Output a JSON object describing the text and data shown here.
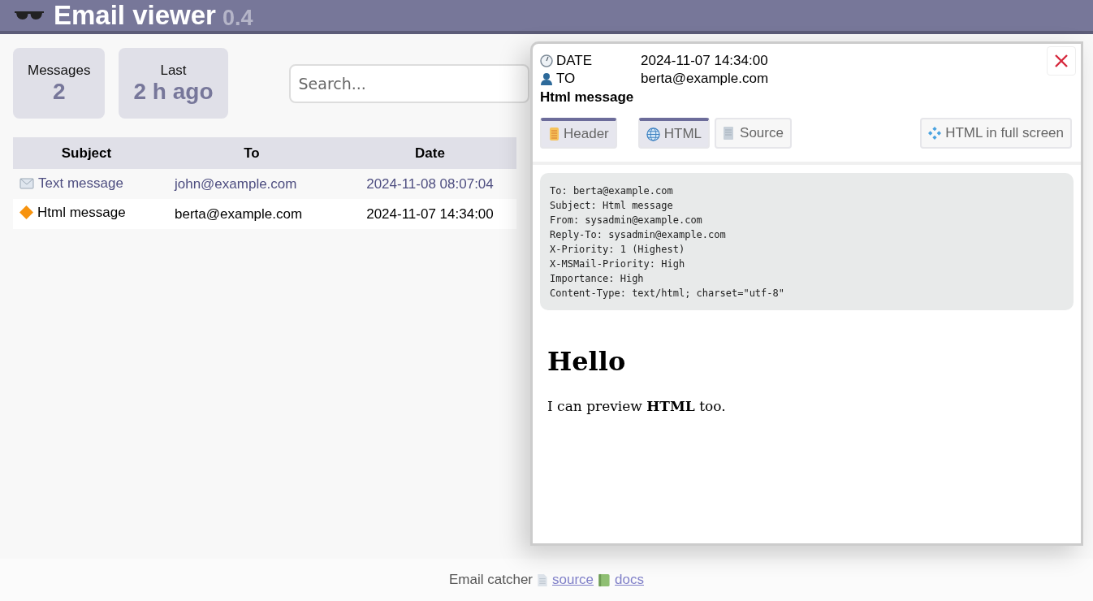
{
  "app": {
    "title": "Email viewer",
    "version": "0.4"
  },
  "stats": [
    {
      "label": "Messages",
      "value": "2"
    },
    {
      "label": "Last",
      "value": "2 h ago"
    }
  ],
  "search": {
    "placeholder": "Search..."
  },
  "table": {
    "columns": [
      "Subject",
      "To",
      "Date"
    ],
    "rows": [
      {
        "kind": "text",
        "subject": "Text message",
        "to": "john@example.com",
        "date": "2024-11-08 08:07:04",
        "selected": false
      },
      {
        "kind": "html",
        "subject": "Html message",
        "to": "berta@example.com",
        "date": "2024-11-07 14:34:00",
        "selected": true
      }
    ]
  },
  "viewer": {
    "date_label": "DATE",
    "date": "2024-11-07 14:34:00",
    "to_label": "TO",
    "to": "berta@example.com",
    "subject": "Html message",
    "toggles": [
      {
        "kind": "header",
        "label": "Header",
        "on": true
      },
      {
        "kind": "html",
        "label": "HTML",
        "on": true
      },
      {
        "kind": "source",
        "label": "Source",
        "on": false
      }
    ],
    "fullscreen": "HTML in full screen",
    "headers": [
      "To: berta@example.com",
      "Subject: Html message",
      "From: sysadmin@example.com",
      "Reply-To: sysadmin@example.com",
      "X-Priority: 1 (Highest)",
      "X-MSMail-Priority: High",
      "Importance: High",
      "Content-Type: text/html; charset=\"utf-8\""
    ],
    "preview": {
      "heading": "Hello",
      "text": "I can preview **HTML** too."
    }
  },
  "footer": {
    "text": "Email catcher",
    "links": [
      {
        "kind": "source",
        "label": "source"
      },
      {
        "kind": "docs",
        "label": "docs"
      }
    ]
  }
}
